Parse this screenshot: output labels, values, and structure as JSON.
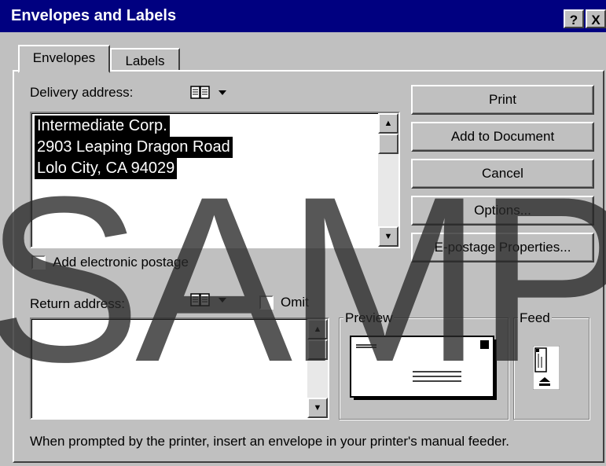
{
  "window": {
    "title": "Envelopes and Labels",
    "help_button": "?",
    "close_button": "X"
  },
  "tabs": [
    {
      "label": "Envelopes",
      "active": true
    },
    {
      "label": "Labels",
      "active": false
    }
  ],
  "delivery": {
    "label": "Delivery address:",
    "lines": [
      "Intermediate Corp.",
      "2903 Leaping Dragon Road",
      "Lolo City, CA 94029"
    ]
  },
  "postage": {
    "label": "Add electronic postage",
    "checked": false
  },
  "return_address": {
    "label": "Return address:",
    "omit_label": "Omit",
    "omit_checked": false,
    "value": ""
  },
  "buttons": {
    "print": "Print",
    "add_to_document": "Add to Document",
    "cancel": "Cancel",
    "options": "Options...",
    "epostage": "E-postage Properties..."
  },
  "preview": {
    "label": "Preview"
  },
  "feed": {
    "label": "Feed"
  },
  "status": {
    "message": "When prompted by the printer, insert an envelope in your printer's manual feeder."
  },
  "watermark": {
    "text": "SAMP"
  },
  "icons": {
    "address_book": "address-book-icon",
    "dropdown": "dropdown-arrow-icon",
    "scroll_up": "scroll-up-icon",
    "scroll_down": "scroll-down-icon"
  }
}
